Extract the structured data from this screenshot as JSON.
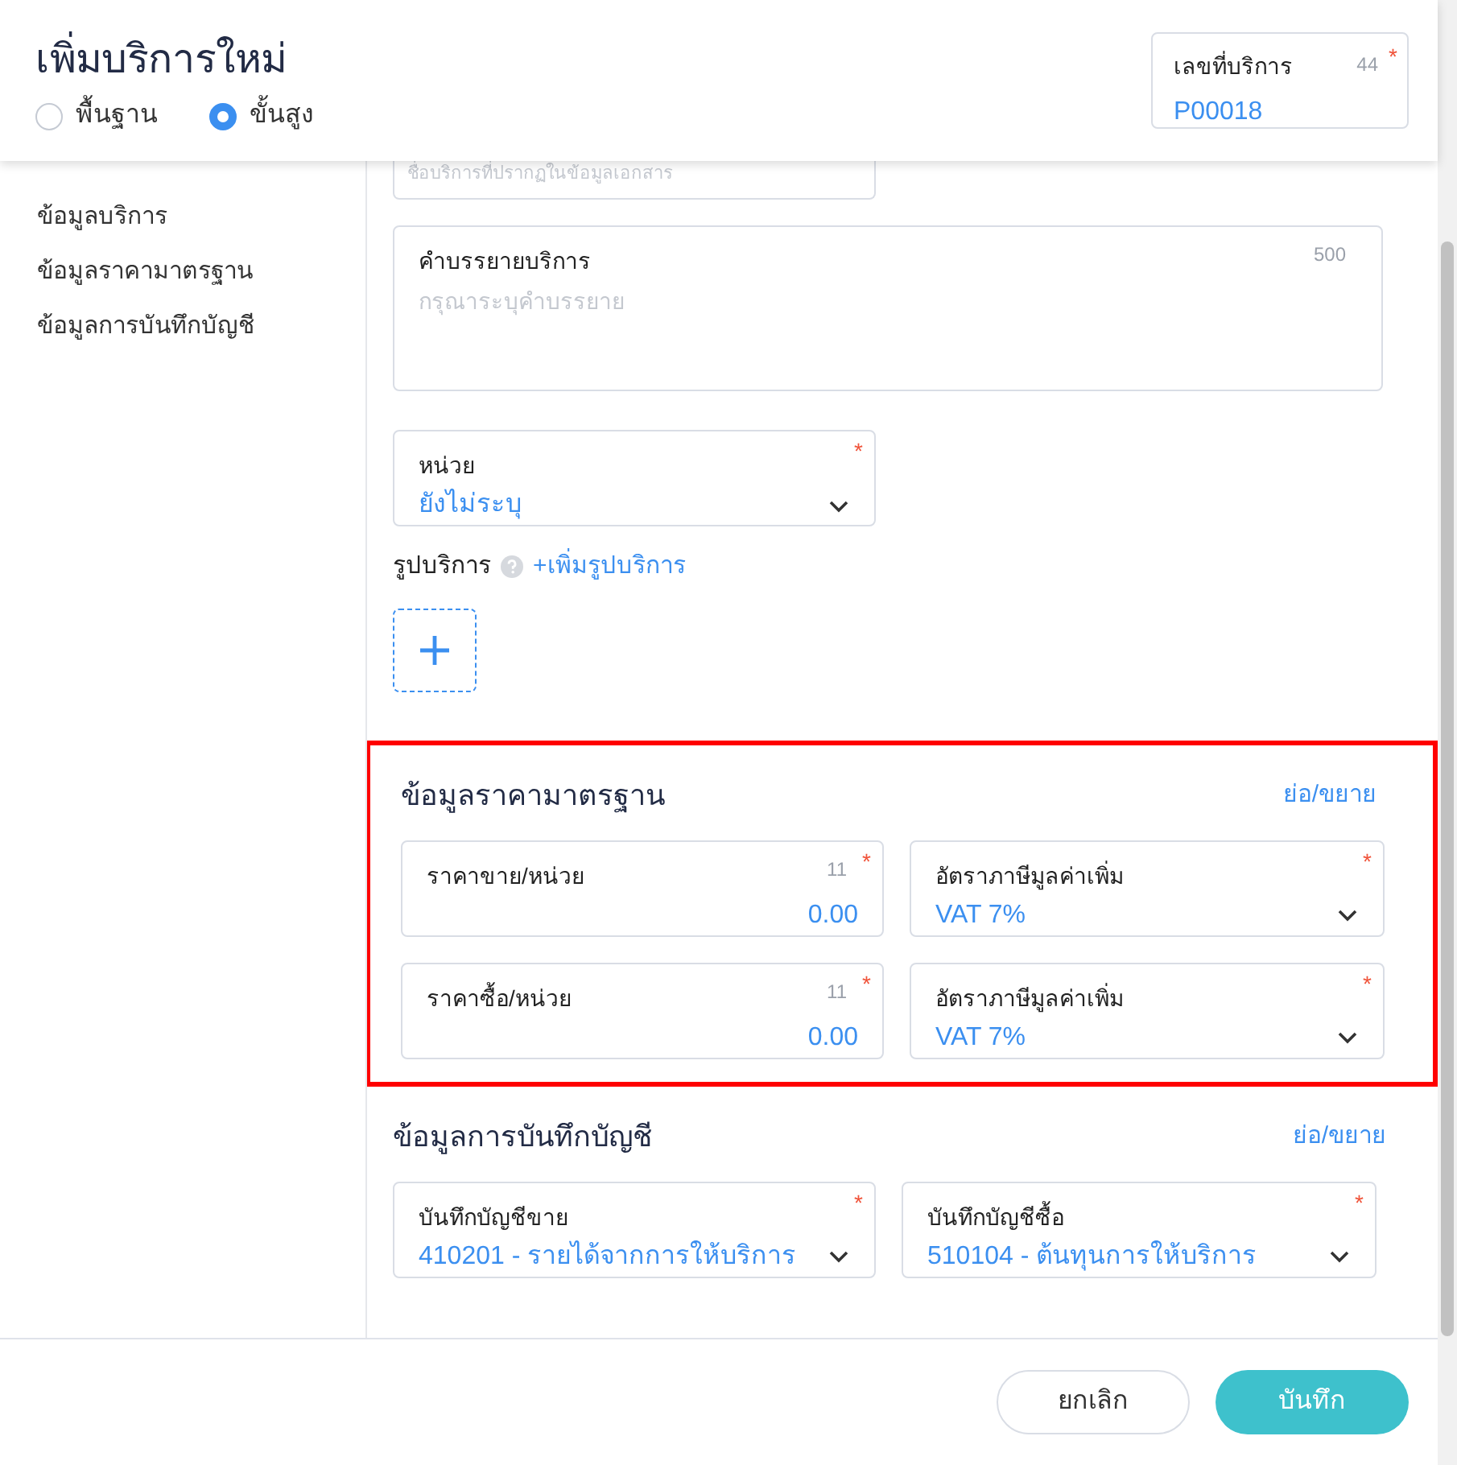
{
  "title": "เพิ่มบริการใหม่",
  "modes": [
    {
      "label": "พื้นฐาน",
      "selected": false
    },
    {
      "label": "ขั้นสูง",
      "selected": true
    }
  ],
  "service_no": {
    "label": "เลขที่บริการ",
    "counter": "44",
    "required_mark": "*",
    "value": "P00018"
  },
  "sidebar": {
    "items": [
      "ข้อมูลบริการ",
      "ข้อมูลราคามาตรฐาน",
      "ข้อมูลการบันทึกบัญชี"
    ]
  },
  "name_field": {
    "placeholder": "ชื่อบริการที่ปรากฏในข้อมูลเอกสาร"
  },
  "description": {
    "label": "คำบรรยายบริการ",
    "counter": "500",
    "placeholder": "กรุณาระบุคำบรรยาย"
  },
  "unit": {
    "label": "หน่วย",
    "required_mark": "*",
    "value": "ยังไม่ระบุ"
  },
  "images": {
    "label": "รูปบริการ",
    "add_link": "+เพิ่มรูปบริการ"
  },
  "sections": [
    {
      "title": "ข้อมูลราคามาตรฐาน",
      "toggle": "ย่อ/ขยาย",
      "highlighted": true,
      "fields": [
        {
          "kind": "number",
          "label": "ราคาขาย/หน่วย",
          "counter": "11",
          "required_mark": "*",
          "value": "0.00"
        },
        {
          "kind": "select",
          "label": "อัตราภาษีมูลค่าเพิ่ม",
          "required_mark": "*",
          "value": "VAT 7%"
        },
        {
          "kind": "number",
          "label": "ราคาซื้อ/หน่วย",
          "counter": "11",
          "required_mark": "*",
          "value": "0.00"
        },
        {
          "kind": "select",
          "label": "อัตราภาษีมูลค่าเพิ่ม",
          "required_mark": "*",
          "value": "VAT 7%"
        }
      ]
    },
    {
      "title": "ข้อมูลการบันทึกบัญชี",
      "toggle": "ย่อ/ขยาย",
      "highlighted": false,
      "fields": [
        {
          "kind": "select",
          "label": "บันทึกบัญชีขาย",
          "required_mark": "*",
          "value": "410201 - รายได้จากการให้บริการ"
        },
        {
          "kind": "select",
          "label": "บันทึกบัญชีซื้อ",
          "required_mark": "*",
          "value": "510104 - ต้นทุนการให้บริการ"
        }
      ]
    }
  ],
  "buttons": [
    {
      "label": "ยกเลิก",
      "kind": "secondary"
    },
    {
      "label": "บันทึก",
      "kind": "primary"
    }
  ]
}
